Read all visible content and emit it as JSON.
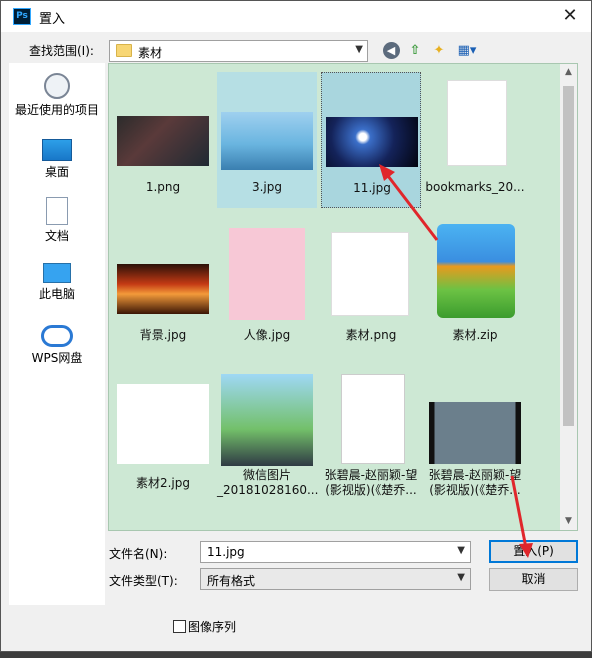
{
  "window": {
    "title": "置入",
    "app_icon": "Ps"
  },
  "toolbar": {
    "lookin_label": "查找范围(I):",
    "lookin_value": "素材"
  },
  "places": [
    {
      "label": "最近使用的项目",
      "icon": "recent-icon"
    },
    {
      "label": "桌面",
      "icon": "desktop-icon"
    },
    {
      "label": "文档",
      "icon": "document-icon"
    },
    {
      "label": "此电脑",
      "icon": "computer-icon"
    },
    {
      "label": "WPS网盘",
      "icon": "cloud-icon"
    }
  ],
  "files": [
    {
      "name": "1.png"
    },
    {
      "name": "3.jpg"
    },
    {
      "name": "11.jpg"
    },
    {
      "name": "bookmarks_20..."
    },
    {
      "name": "背景.jpg"
    },
    {
      "name": "人像.jpg"
    },
    {
      "name": "素材.png"
    },
    {
      "name": "素材.zip"
    },
    {
      "name": "素材2.jpg"
    },
    {
      "name": "微信图片\n_20181028160..."
    },
    {
      "name": "张碧晨-赵丽颖-望\n(影视版)(《楚乔..."
    },
    {
      "name": "张碧晨-赵丽颖-望\n(影视版)(《楚乔..."
    }
  ],
  "form": {
    "filename_label": "文件名(N):",
    "filename_value": "11.jpg",
    "filetype_label": "文件类型(T):",
    "filetype_value": "所有格式"
  },
  "buttons": {
    "place": "置入(P)",
    "cancel": "取消"
  },
  "options": {
    "image_sequence_label": "图像序列",
    "image_sequence_checked": false
  },
  "colors": {
    "pane_bg": "#cde8d4",
    "selection": "#a9d6de",
    "annotation_arrow": "#e0262b"
  }
}
